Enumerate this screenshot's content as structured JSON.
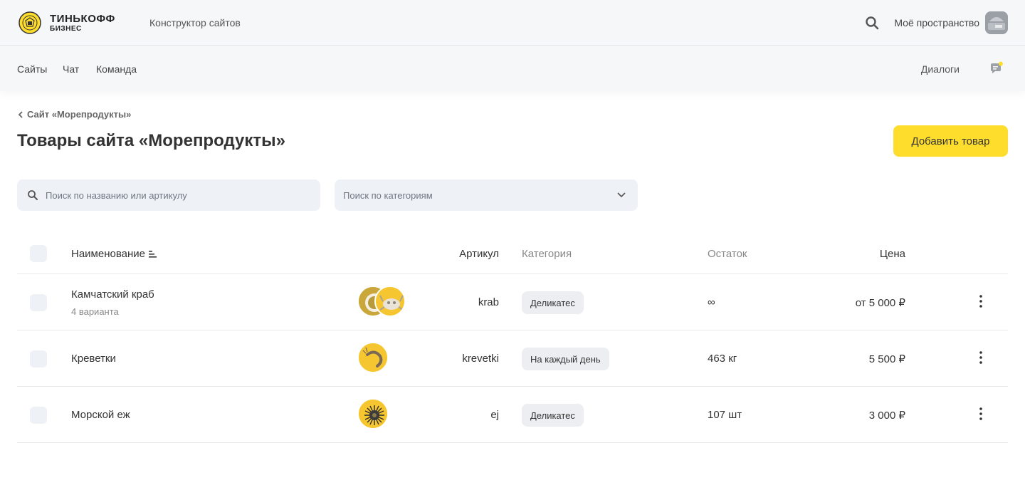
{
  "header": {
    "brand_line1": "ТИНЬКОФФ",
    "brand_line2": "БИЗНЕС",
    "product": "Конструктор сайтов",
    "workspace": "Моё пространство",
    "nav": [
      {
        "label": "Сайты"
      },
      {
        "label": "Чат"
      },
      {
        "label": "Команда"
      }
    ],
    "dialogs": "Диалоги",
    "accent": "#ffdd2d"
  },
  "breadcrumb": "Сайт «Морепродукты»",
  "page_title": "Товары сайта «Морепродукты»",
  "add_button": "Добавить товар",
  "search": {
    "placeholder": "Поиск по названию или артикулу"
  },
  "category_filter": {
    "placeholder": "Поиск по категориям"
  },
  "table": {
    "columns": {
      "name": "Наименование",
      "article": "Артикул",
      "category": "Категория",
      "stock": "Остаток",
      "price": "Цена"
    },
    "rows": [
      {
        "name": "Камчатский краб",
        "variants": "4 варианта",
        "article": "krab",
        "category": "Деликатес",
        "stock": "∞",
        "price": "от 5 000 ₽",
        "image": "crab-thumbnail"
      },
      {
        "name": "Креветки",
        "variants": "",
        "article": "krevetki",
        "category": "На каждый день",
        "stock": "463 кг",
        "price": "5 500 ₽",
        "image": "shrimp-thumbnail"
      },
      {
        "name": "Морской еж",
        "variants": "",
        "article": "ej",
        "category": "Деликатес",
        "stock": "107 шт",
        "price": "3 000 ₽",
        "image": "sea-urchin-thumbnail"
      }
    ]
  }
}
